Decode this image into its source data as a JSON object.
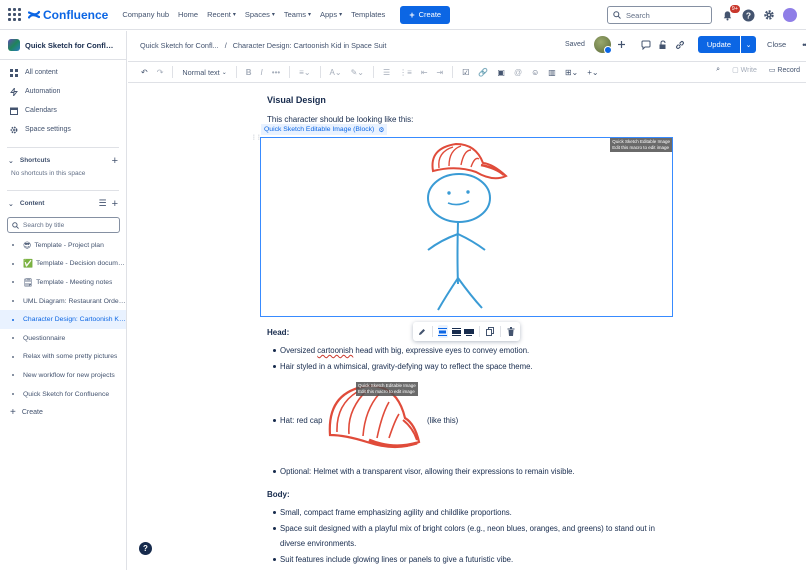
{
  "topnav": {
    "logo_text": "Confluence",
    "items": [
      {
        "label": "Company hub",
        "dropdown": false
      },
      {
        "label": "Home",
        "dropdown": false
      },
      {
        "label": "Recent",
        "dropdown": true
      },
      {
        "label": "Spaces",
        "dropdown": true
      },
      {
        "label": "Teams",
        "dropdown": true
      },
      {
        "label": "Apps",
        "dropdown": true
      },
      {
        "label": "Templates",
        "dropdown": false
      }
    ],
    "create_label": "Create",
    "search_placeholder": "Search",
    "notification_count": "9+",
    "accent": "#0c66e4"
  },
  "sidebar": {
    "space_name": "Quick Sketch for Confluence",
    "links": [
      {
        "label": "All content",
        "icon": "all-content-icon"
      },
      {
        "label": "Automation",
        "icon": "automation-icon"
      },
      {
        "label": "Calendars",
        "icon": "calendar-icon"
      },
      {
        "label": "Space settings",
        "icon": "gear-icon"
      }
    ],
    "shortcuts_title": "Shortcuts",
    "shortcuts_empty": "No shortcuts in this space",
    "content_title": "Content",
    "search_placeholder": "Search by title",
    "tree": [
      {
        "emoji": "😎",
        "label": "Template - Project plan",
        "active": false
      },
      {
        "emoji": "✅",
        "label": "Template - Decision documentation",
        "active": false
      },
      {
        "emoji": "🗒",
        "label": "Template - Meeting notes",
        "active": false
      },
      {
        "emoji": "",
        "label": "UML Diagram: Restaurant Ordering",
        "active": false
      },
      {
        "emoji": "",
        "label": "Character Design: Cartoonish Kid in Space Suit",
        "active": true
      },
      {
        "emoji": "",
        "label": "Questionnaire",
        "active": false
      },
      {
        "emoji": "",
        "label": "Relax with some pretty pictures",
        "active": false
      },
      {
        "emoji": "",
        "label": "New workflow for new projects",
        "active": false
      },
      {
        "emoji": "",
        "label": "Quick Sketch for Confluence",
        "active": false
      }
    ],
    "create_label": "Create"
  },
  "editor_header": {
    "breadcrumb": [
      "Quick Sketch for Confl...",
      "/",
      "Character Design: Cartoonish Kid in Space Suit"
    ],
    "saved_label": "Saved",
    "update_label": "Update",
    "close_label": "Close"
  },
  "toolbar": {
    "text_style": "Normal text",
    "write_label": "Write",
    "record_label": "Record"
  },
  "page": {
    "heading_visual": "Visual Design",
    "intro": "This character should be looking like this:",
    "macro_label": "Quick Sketch Editable Image (Block)",
    "macro_tooltip_line1": "Quick Sketch Editable Image",
    "macro_tooltip_line2": "Edit this macro to edit image",
    "heading_head": "Head:",
    "head_bullets": [
      {
        "pre": "Oversized ",
        "spell": "cartoonish",
        "post": " head with big, expressive eyes to convey emotion."
      },
      {
        "pre": "Hair styled in a whimsical, gravity-defying way to reflect the space theme.",
        "spell": "",
        "post": ""
      }
    ],
    "hat_pre": "Hat: red cap",
    "hat_post": "(like this)",
    "optional_bullet": "Optional: Helmet with a transparent visor, allowing their expressions to remain visible.",
    "heading_body": "Body:",
    "body_bullets": [
      "Small, compact frame emphasizing agility and childlike proportions.",
      "Space suit designed with a playful mix of bright colors (e.g., neon blues, oranges, and greens) to stand out in diverse environments.",
      "Suit features include glowing lines or panels to give a futuristic vibe."
    ]
  },
  "colors": {
    "sketch_red": "#e04b3a",
    "sketch_blue": "#3a9bd5",
    "selection": "#388bff"
  }
}
